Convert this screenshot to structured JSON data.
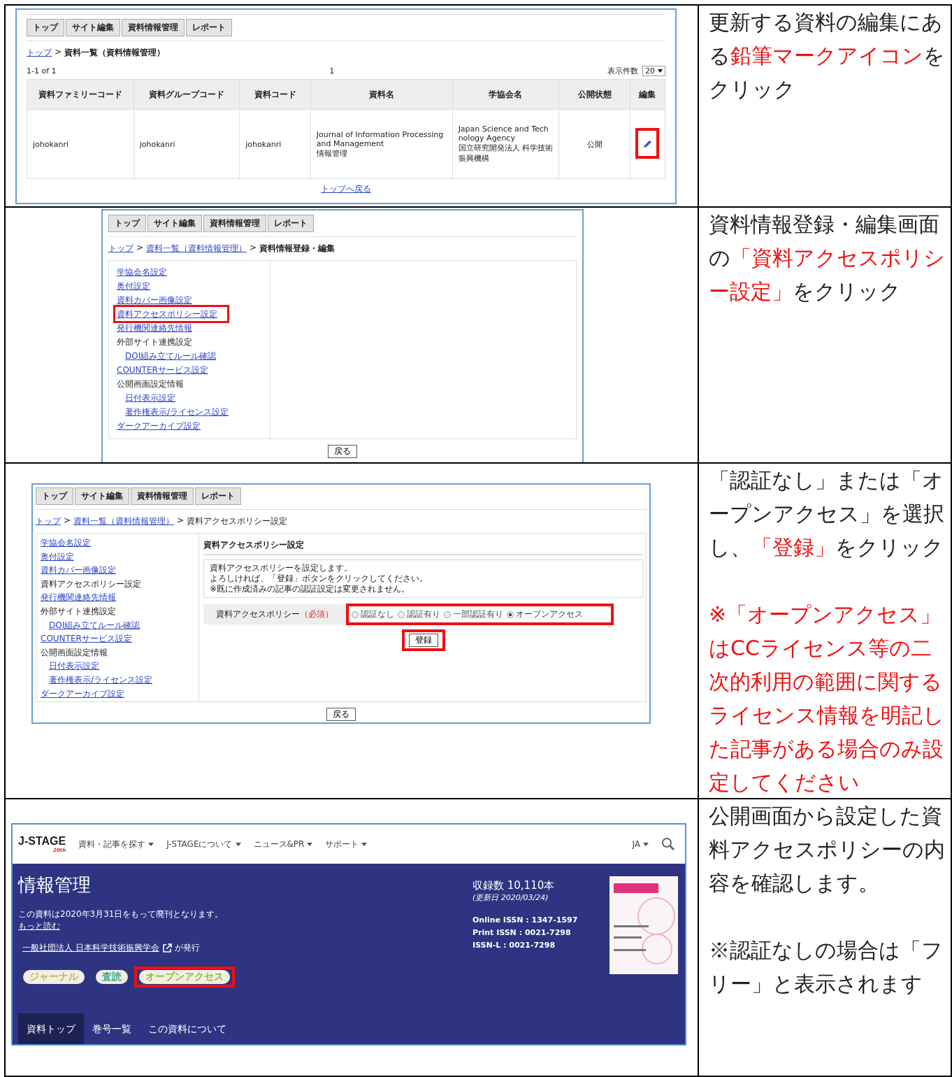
{
  "list_screen": {
    "tabs": [
      "トップ",
      "サイト編集",
      "資料情報管理",
      "レポート"
    ],
    "breadcrumb": [
      {
        "text": "トップ",
        "kind": "link"
      },
      {
        "text": "資料一覧（資料情報管理）",
        "kind": "current"
      }
    ],
    "separator": ">",
    "range": "1-1 of 1",
    "page": "1",
    "per_page_label": "表示件数",
    "per_page": "20",
    "table": {
      "columns": [
        "資料ファミリーコード",
        "資料グループコード",
        "資料コード",
        "資料名",
        "学協会名",
        "公開状態",
        "編集"
      ],
      "rows": [
        {
          "cells": [
            {
              "kind": "text",
              "text": "johokanri"
            },
            {
              "kind": "text",
              "text": "johokanri"
            },
            {
              "kind": "text",
              "text": "johokanri"
            },
            {
              "kind": "text",
              "text": "Journal of Information Processing and Management\n情報管理"
            },
            {
              "kind": "text",
              "text": "Japan Science and Technology Agency\n国立研究開発法人 科学技術振興機構"
            },
            {
              "kind": "center",
              "text": "公開"
            },
            {
              "kind": "edit",
              "highlighted": true
            }
          ]
        }
      ]
    },
    "back_link": "トップへ戻る"
  },
  "edit_screen": {
    "tabs": [
      "トップ",
      "サイト編集",
      "資料情報管理",
      "レポート"
    ],
    "breadcrumb": [
      {
        "text": "トップ",
        "kind": "link"
      },
      {
        "text": "資料一覧（資料情報管理）",
        "kind": "link"
      },
      {
        "text": "資料情報登録・編集",
        "kind": "current"
      }
    ],
    "separator": ">",
    "menu": [
      {
        "label": "学協会名設定",
        "kind": "link",
        "highlighted": false
      },
      {
        "label": "奥付設定",
        "kind": "link",
        "highlighted": false
      },
      {
        "label": "資料カバー画像設定",
        "kind": "link",
        "highlighted": false
      },
      {
        "label": "資料アクセスポリシー設定",
        "kind": "link",
        "highlighted": true
      },
      {
        "label": "発行機関連絡先情報",
        "kind": "link",
        "highlighted": false
      },
      {
        "label": "外部サイト連携設定",
        "kind": "heading",
        "highlighted": false,
        "children": [
          {
            "label": "DOI組み立てルール確認",
            "kind": "link",
            "highlighted": false
          }
        ]
      },
      {
        "label": "COUNTERサービス設定",
        "kind": "link",
        "highlighted": false
      },
      {
        "label": "公開画面設定情報",
        "kind": "heading",
        "highlighted": false,
        "children": [
          {
            "label": "日付表示設定",
            "kind": "link",
            "highlighted": false
          },
          {
            "label": "著作権表示/ライセンス設定",
            "kind": "link",
            "highlighted": false
          }
        ]
      },
      {
        "label": "ダークアーカイブ設定",
        "kind": "link",
        "highlighted": false
      }
    ],
    "back_button": "戻る"
  },
  "policy_screen": {
    "tabs": [
      "トップ",
      "サイト編集",
      "資料情報管理",
      "レポート"
    ],
    "breadcrumb": [
      {
        "text": "トップ",
        "kind": "link"
      },
      {
        "text": "資料一覧（資料情報管理）",
        "kind": "link"
      },
      {
        "text": "資料アクセスポリシー設定",
        "kind": "plain"
      }
    ],
    "separator": ">",
    "menu": [
      {
        "label": "学協会名設定",
        "kind": "link"
      },
      {
        "label": "奥付設定",
        "kind": "link"
      },
      {
        "label": "資料カバー画像設定",
        "kind": "link"
      },
      {
        "label": "資料アクセスポリシー設定",
        "kind": "heading"
      },
      {
        "label": "発行機関連絡先情報",
        "kind": "link"
      },
      {
        "label": "外部サイト連携設定",
        "kind": "heading",
        "children": [
          {
            "label": "DOI組み立てルール確認",
            "kind": "link"
          }
        ]
      },
      {
        "label": "COUNTERサービス設定",
        "kind": "link"
      },
      {
        "label": "公開画面設定情報",
        "kind": "heading",
        "children": [
          {
            "label": "日付表示設定",
            "kind": "link"
          },
          {
            "label": "著作権表示/ライセンス設定",
            "kind": "link"
          }
        ]
      },
      {
        "label": "ダークアーカイブ設定",
        "kind": "link"
      }
    ],
    "section_title": "資料アクセスポリシー設定",
    "description": [
      "資料アクセスポリシーを設定します。",
      "よろしければ、「登録」ボタンをクリックしてください。",
      "※既に作成済みの記事の認証設定は変更されません。"
    ],
    "field_label": "資料アクセスポリシー",
    "required": "（必須）",
    "options_highlighted": true,
    "options": [
      {
        "label": "認証なし",
        "selected": false
      },
      {
        "label": "認証有り",
        "selected": false
      },
      {
        "label": "一部認証有り",
        "selected": false
      },
      {
        "label": "オープンアクセス",
        "selected": true
      }
    ],
    "submit": {
      "label": "登録",
      "highlighted": true
    },
    "back_button": "戻る"
  },
  "public_screen": {
    "logo": "J-STAGE",
    "logo_badge": "20th",
    "nav": [
      "資料・記事を探す",
      "J-STAGEについて",
      "ニュース&PR",
      "サポート"
    ],
    "language": "JA",
    "title": "情報管理",
    "notice": "この資料は2020年3月31日をもって廃刊となります。",
    "read_more": "もっと読む",
    "publisher": "一般社団法人 日本科学技術振興学会",
    "publisher_suffix": "が発行",
    "tags": [
      {
        "label": "ジャーナル",
        "color": "#c8b45a",
        "highlighted": false
      },
      {
        "label": "査読",
        "color": "#3fa88c",
        "highlighted": false
      },
      {
        "label": "オープンアクセス",
        "color": "#8dbd3f",
        "highlighted": true
      }
    ],
    "tabs": [
      {
        "label": "資料トップ",
        "selected": true
      },
      {
        "label": "巻号一覧",
        "selected": false
      },
      {
        "label": "この資料について",
        "selected": false
      }
    ],
    "count": "収録数 10,110本",
    "updated": "(更新日 2020/03/24)",
    "issn": [
      "Online ISSN : 1347-1597",
      "Print ISSN : 0021-7298",
      "ISSN-L : 0021-7298"
    ]
  },
  "instructions": [
    {
      "paragraphs": [
        {
          "segments": [
            {
              "text": "更新する資料の編集にある",
              "highlight": false
            },
            {
              "text": "鉛筆マークアイコン",
              "highlight": true
            },
            {
              "text": "をクリック",
              "highlight": false
            }
          ]
        }
      ]
    },
    {
      "paragraphs": [
        {
          "segments": [
            {
              "text": "資料情報登録・編集画面の",
              "highlight": false
            },
            {
              "text": "「資料アクセスポリシー設定」",
              "highlight": true
            },
            {
              "text": "をクリック",
              "highlight": false
            }
          ]
        }
      ]
    },
    {
      "paragraphs": [
        {
          "segments": [
            {
              "text": "「認証なし」または「オープンアクセス」を選択し、",
              "highlight": false
            },
            {
              "text": "「登録」",
              "highlight": true
            },
            {
              "text": "をクリック",
              "highlight": false
            }
          ]
        },
        {
          "segments": [
            {
              "text": "※「オープンアクセス」はCCライセンス等の二次的利用の範囲に関するライセンス情報を明記した記事がある場合のみ設定してください",
              "highlight": true
            }
          ]
        }
      ]
    },
    {
      "paragraphs": [
        {
          "segments": [
            {
              "text": "公開画面から設定した資料アクセスポリシーの内容を確認します。",
              "highlight": false
            }
          ]
        },
        {
          "segments": [
            {
              "text": "※認証なしの場合は「フリー」と表示されます",
              "highlight": false
            }
          ]
        }
      ]
    }
  ]
}
